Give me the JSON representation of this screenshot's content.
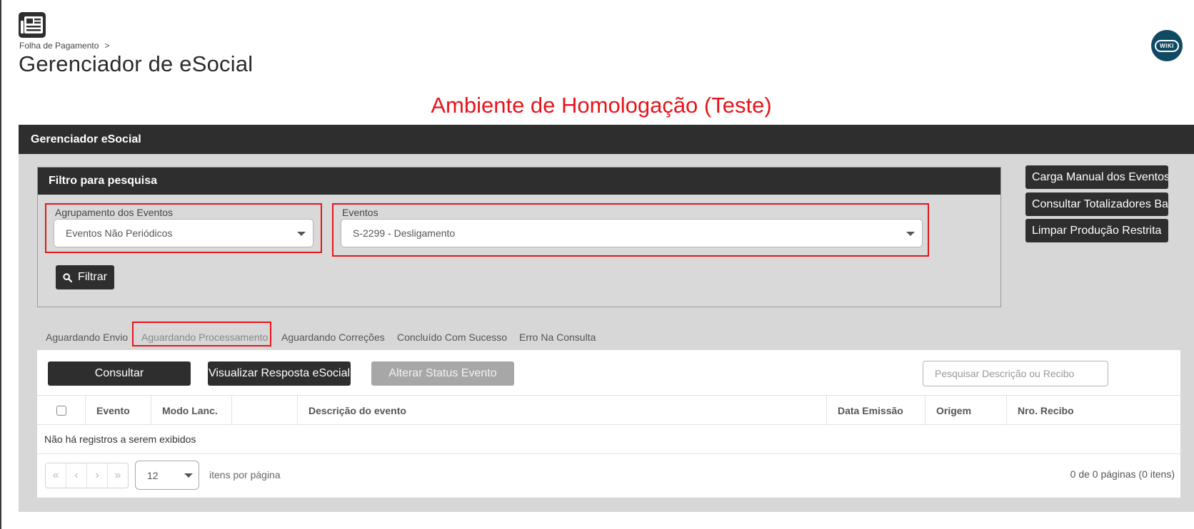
{
  "breadcrumb": {
    "parent": "Folha de Pagamento",
    "separator": ">"
  },
  "page_title": "Gerenciador de eSocial",
  "wiki_label": "WIKI",
  "environment_title": "Ambiente de Homologação (Teste)",
  "main_panel": {
    "title": "Gerenciador eSocial"
  },
  "filter": {
    "title": "Filtro para pesquisa",
    "grouping": {
      "label": "Agrupamento dos Eventos",
      "value": "Eventos Não Periódicos"
    },
    "events": {
      "label": "Eventos",
      "value": "S-2299 - Desligamento"
    },
    "filter_button": "Filtrar"
  },
  "side_buttons": {
    "manual_load": "Carga Manual dos Eventos",
    "totals": "Consultar Totalizadores Base",
    "clear": "Limpar Produção Restrita"
  },
  "tabs": [
    {
      "label": "Aguardando Envio",
      "active": false
    },
    {
      "label": "Aguardando Processamento",
      "active": true
    },
    {
      "label": "Aguardando Correções",
      "active": false
    },
    {
      "label": "Concluído Com Sucesso",
      "active": false
    },
    {
      "label": "Erro Na Consulta",
      "active": false
    }
  ],
  "actions": {
    "consultar": "Consultar",
    "view_response": "Visualizar Resposta eSocial",
    "change_status": "Alterar Status Evento",
    "search_placeholder": "Pesquisar Descrição ou Recibo"
  },
  "table": {
    "columns": [
      "Evento",
      "Modo Lanc.",
      "",
      "Descrição do evento",
      "Data Emissão",
      "Origem",
      "Nro. Recibo"
    ],
    "empty_message": "Não há registros a serem exibidos"
  },
  "pager": {
    "first": "«",
    "prev": "‹",
    "next": "›",
    "last": "»",
    "page_size": "12",
    "items_per_page": "itens por página",
    "info": "0 de 0 páginas (0 itens)"
  },
  "colors": {
    "alert_red": "#e8141b",
    "dark": "#2e2e2e",
    "wiki_bg": "#0f4a63"
  }
}
